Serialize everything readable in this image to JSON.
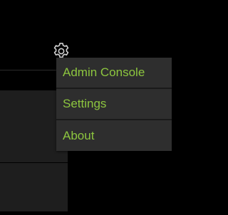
{
  "header": {
    "settings_icon": "gear-icon"
  },
  "menu": {
    "items": [
      {
        "label": "Admin Console"
      },
      {
        "label": "Settings"
      },
      {
        "label": "About"
      }
    ]
  },
  "colors": {
    "background": "#000000",
    "menu_background": "#2e2e2e",
    "menu_text": "#8dc63f",
    "icon": "#cfcfcf",
    "panel": "#1e1e1e"
  }
}
